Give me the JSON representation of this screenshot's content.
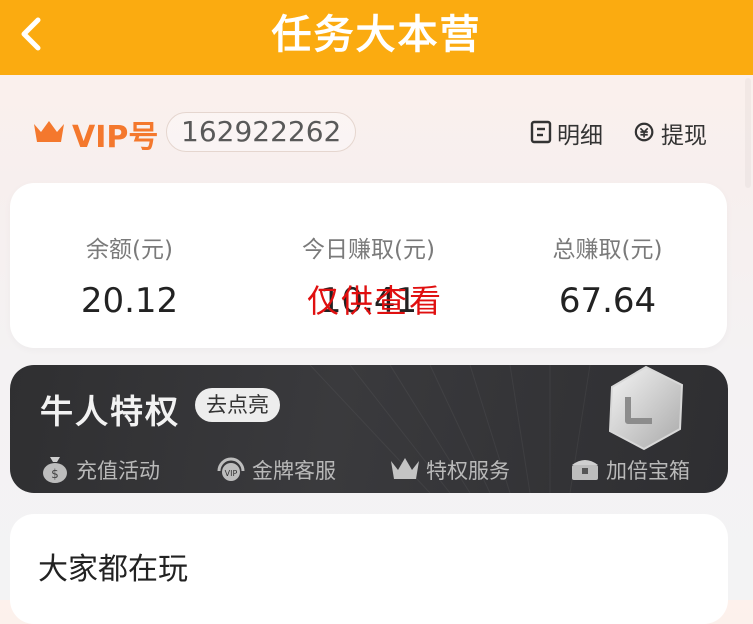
{
  "header": {
    "title": "任务大本营",
    "back_icon": "chevron-left-icon"
  },
  "account": {
    "vip_label": "VIP号",
    "vip_id": "162922262",
    "detail_label": "明细",
    "withdraw_label": "提现"
  },
  "stats": [
    {
      "label": "余额(元)",
      "value": "20.12"
    },
    {
      "label": "今日赚取(元)",
      "value": "10.41"
    },
    {
      "label": "总赚取(元)",
      "value": "67.64"
    }
  ],
  "watermark": "仅供查看",
  "privilege": {
    "title": "牛人特权",
    "action_label": "去点亮",
    "items": [
      {
        "label": "充值活动",
        "icon": "money-bag-icon"
      },
      {
        "label": "金牌客服",
        "icon": "vip-headset-icon"
      },
      {
        "label": "特权服务",
        "icon": "crown-icon"
      },
      {
        "label": "加倍宝箱",
        "icon": "treasure-chest-icon"
      }
    ]
  },
  "everyone_playing": {
    "title": "大家都在玩"
  },
  "colors": {
    "header_bg": "#fbab10",
    "vip_accent": "#f4782d",
    "privilege_bg": "#333336",
    "watermark": "#e01010"
  }
}
